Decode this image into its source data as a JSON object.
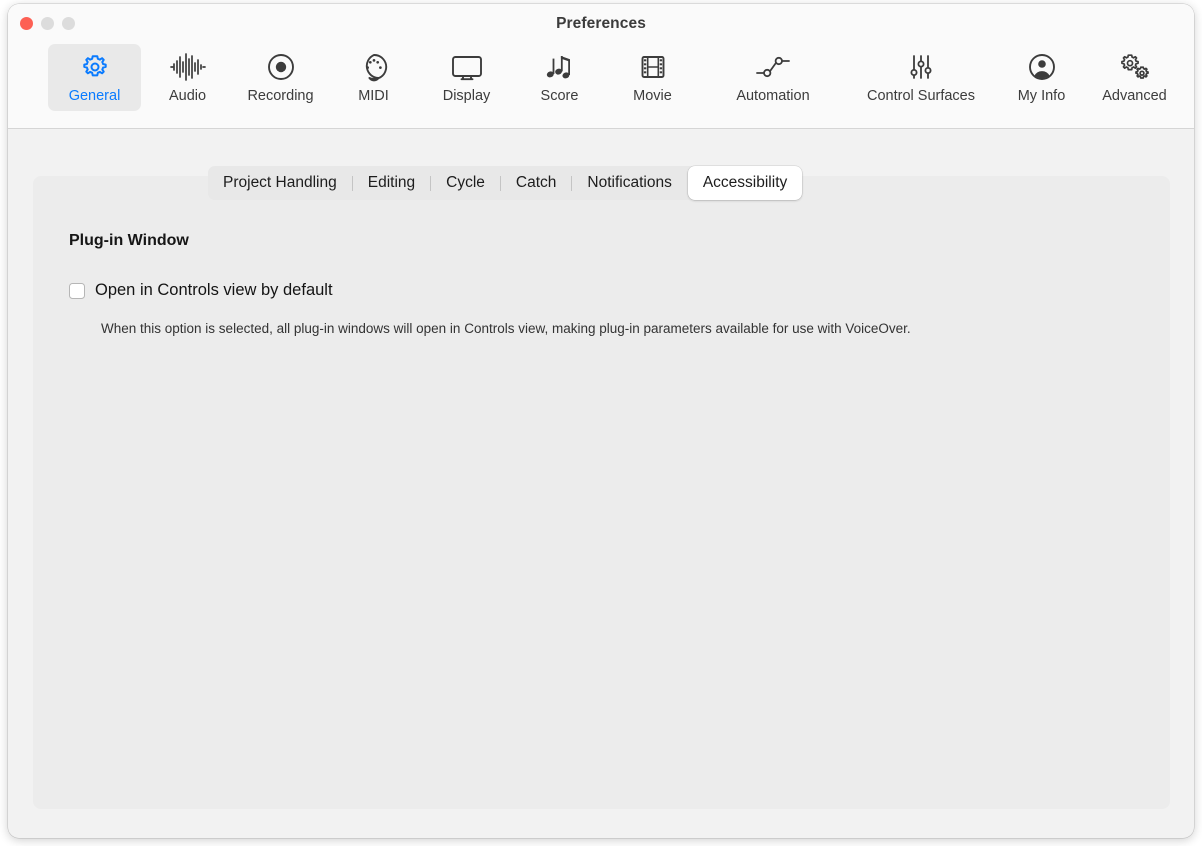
{
  "window": {
    "title": "Preferences",
    "traffic_lights": [
      {
        "name": "close",
        "color": "#fd6054"
      },
      {
        "name": "minimize",
        "color": "#dcdcdc"
      },
      {
        "name": "zoom",
        "color": "#dcdcdc"
      }
    ]
  },
  "toolbar": {
    "accent_color": "#0a7bff",
    "items": [
      {
        "label": "General",
        "icon": "gear-icon",
        "selected": true
      },
      {
        "label": "Audio",
        "icon": "waveform-icon",
        "selected": false
      },
      {
        "label": "Recording",
        "icon": "record-circle-icon",
        "selected": false
      },
      {
        "label": "MIDI",
        "icon": "midi-din-icon",
        "selected": false
      },
      {
        "label": "Display",
        "icon": "monitor-icon",
        "selected": false
      },
      {
        "label": "Score",
        "icon": "music-notes-icon",
        "selected": false
      },
      {
        "label": "Movie",
        "icon": "film-strip-icon",
        "selected": false
      },
      {
        "label": "Automation",
        "icon": "automation-nodes-icon",
        "selected": false
      },
      {
        "label": "Control Surfaces",
        "icon": "sliders-icon",
        "selected": false
      },
      {
        "label": "My Info",
        "icon": "person-circle-icon",
        "selected": false
      },
      {
        "label": "Advanced",
        "icon": "double-gear-icon",
        "selected": false
      }
    ]
  },
  "segmented_tabs": {
    "items": [
      {
        "label": "Project Handling",
        "selected": false
      },
      {
        "label": "Editing",
        "selected": false
      },
      {
        "label": "Cycle",
        "selected": false
      },
      {
        "label": "Catch",
        "selected": false
      },
      {
        "label": "Notifications",
        "selected": false
      },
      {
        "label": "Accessibility",
        "selected": true
      }
    ]
  },
  "content": {
    "section_title": "Plug-in Window",
    "checkbox": {
      "label": "Open in Controls view by default",
      "checked": false
    },
    "description": "When this option is selected, all plug-in windows will open in Controls view, making plug-in parameters available for use with VoiceOver."
  }
}
